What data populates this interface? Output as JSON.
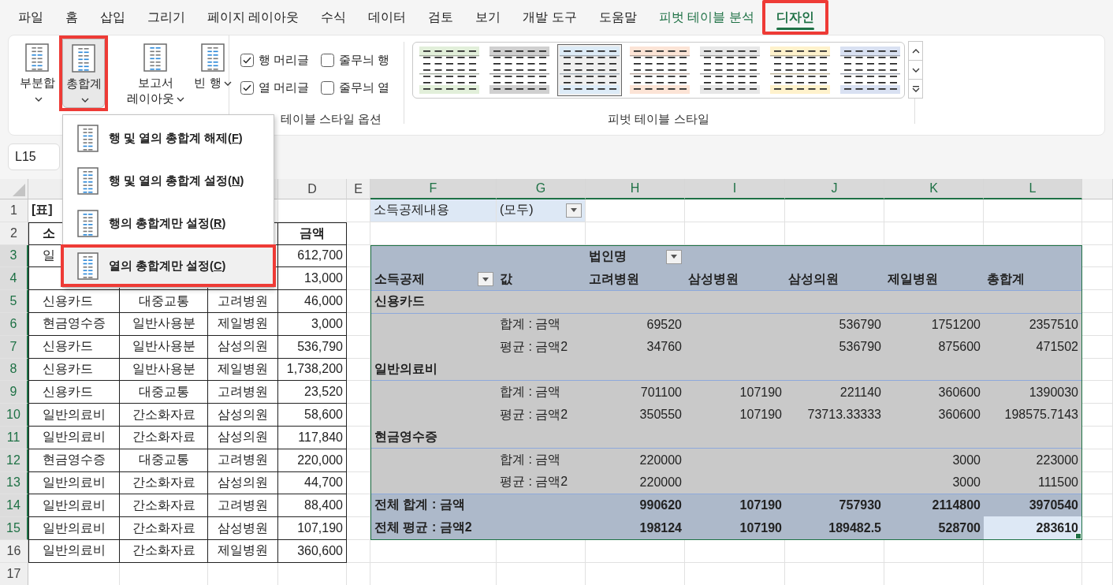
{
  "tabs": [
    {
      "label": "파일",
      "selected": false,
      "contextual": false,
      "highlighted": false
    },
    {
      "label": "홈",
      "selected": false,
      "contextual": false,
      "highlighted": false
    },
    {
      "label": "삽입",
      "selected": false,
      "contextual": false,
      "highlighted": false
    },
    {
      "label": "그리기",
      "selected": false,
      "contextual": false,
      "highlighted": false
    },
    {
      "label": "페이지 레이아웃",
      "selected": false,
      "contextual": false,
      "highlighted": false
    },
    {
      "label": "수식",
      "selected": false,
      "contextual": false,
      "highlighted": false
    },
    {
      "label": "데이터",
      "selected": false,
      "contextual": false,
      "highlighted": false
    },
    {
      "label": "검토",
      "selected": false,
      "contextual": false,
      "highlighted": false
    },
    {
      "label": "보기",
      "selected": false,
      "contextual": false,
      "highlighted": false
    },
    {
      "label": "개발 도구",
      "selected": false,
      "contextual": false,
      "highlighted": false
    },
    {
      "label": "도움말",
      "selected": false,
      "contextual": false,
      "highlighted": false
    },
    {
      "label": "피벗 테이블 분석",
      "selected": false,
      "contextual": true,
      "highlighted": false
    },
    {
      "label": "디자인",
      "selected": true,
      "contextual": true,
      "highlighted": true
    }
  ],
  "ribbon": {
    "layout_buttons": [
      {
        "label": "부분합",
        "pressed": false,
        "highlighted": false
      },
      {
        "label": "총합계",
        "pressed": true,
        "highlighted": true
      },
      {
        "label": "보고서 레이아웃",
        "pressed": false,
        "highlighted": false
      },
      {
        "label": "빈 행",
        "pressed": false,
        "highlighted": false
      }
    ],
    "options": [
      {
        "label": "행 머리글",
        "checked": true
      },
      {
        "label": "줄무늬 행",
        "checked": false
      },
      {
        "label": "열 머리글",
        "checked": true
      },
      {
        "label": "줄무늬 열",
        "checked": false
      }
    ],
    "options_group_label": "테이블 스타일 옵션",
    "styles": [
      {
        "color": "#e2efda",
        "selected": false
      },
      {
        "color": "#d0d0d0",
        "selected": false
      },
      {
        "color": "#ddebf7",
        "selected": true
      },
      {
        "color": "#fce4d6",
        "selected": false
      },
      {
        "color": "#e7e7e7",
        "selected": false
      },
      {
        "color": "#fff2cc",
        "selected": false
      },
      {
        "color": "#d9e1f2",
        "selected": false
      }
    ],
    "styles_group_label": "피벗 테이블 스타일"
  },
  "menu": [
    {
      "label": "행 및 열의 총합계 해제(F)",
      "selected": false,
      "highlighted": false
    },
    {
      "label": "행 및 열의 총합계 설정(N)",
      "selected": false,
      "highlighted": false
    },
    {
      "label": "행의 총합계만 설정(R)",
      "selected": false,
      "highlighted": false
    },
    {
      "label": "열의 총합계만 설정(C)",
      "selected": true,
      "highlighted": true
    }
  ],
  "name_box": "L15",
  "sheet": {
    "col_headers": [
      {
        "label": "D",
        "selected": false
      },
      {
        "label": "E",
        "selected": false
      },
      {
        "label": "F",
        "selected": true
      },
      {
        "label": "G",
        "selected": true
      },
      {
        "label": "H",
        "selected": true
      },
      {
        "label": "I",
        "selected": true
      },
      {
        "label": "J",
        "selected": true
      },
      {
        "label": "K",
        "selected": true
      },
      {
        "label": "L",
        "selected": true
      }
    ],
    "row_headers": [
      {
        "label": "1",
        "selected": false
      },
      {
        "label": "2",
        "selected": false
      },
      {
        "label": "3",
        "selected": true
      },
      {
        "label": "4",
        "selected": true
      },
      {
        "label": "5",
        "selected": true
      },
      {
        "label": "6",
        "selected": true
      },
      {
        "label": "7",
        "selected": true
      },
      {
        "label": "8",
        "selected": true
      },
      {
        "label": "9",
        "selected": true
      },
      {
        "label": "10",
        "selected": true
      },
      {
        "label": "11",
        "selected": true
      },
      {
        "label": "12",
        "selected": true
      },
      {
        "label": "13",
        "selected": true
      },
      {
        "label": "14",
        "selected": true
      },
      {
        "label": "15",
        "selected": true
      },
      {
        "label": "16",
        "selected": false
      },
      {
        "label": "17",
        "selected": false
      }
    ],
    "table": {
      "title": "[표]",
      "header": {
        "column_1": "소",
        "column_4": "금액"
      },
      "rows": [
        {
          "column_1": "일",
          "column_4": "612,700"
        },
        {
          "column_4": "13,000"
        },
        {
          "column_1": "신용카드",
          "column_2": "대중교통",
          "column_3": "고려병원",
          "column_4": "46,000"
        },
        {
          "column_1": "현금영수증",
          "column_2": "일반사용분",
          "column_3": "제일병원",
          "column_4": "3,000"
        },
        {
          "column_1": "신용카드",
          "column_2": "일반사용분",
          "column_3": "삼성의원",
          "column_4": "536,790"
        },
        {
          "column_1": "신용카드",
          "column_2": "일반사용분",
          "column_3": "제일병원",
          "column_4": "1,738,200"
        },
        {
          "column_1": "신용카드",
          "column_2": "대중교통",
          "column_3": "고려병원",
          "column_4": "23,520"
        },
        {
          "column_1": "일반의료비",
          "column_2": "간소화자료",
          "column_3": "삼성의원",
          "column_4": "58,600"
        },
        {
          "column_1": "일반의료비",
          "column_2": "간소화자료",
          "column_3": "삼성의원",
          "column_4": "117,840"
        },
        {
          "column_1": "현금영수증",
          "column_2": "대중교통",
          "column_3": "고려병원",
          "column_4": "220,000"
        },
        {
          "column_1": "일반의료비",
          "column_2": "간소화자료",
          "column_3": "삼성의원",
          "column_4": "44,700"
        },
        {
          "column_1": "일반의료비",
          "column_2": "간소화자료",
          "column_3": "고려병원",
          "column_4": "88,400"
        },
        {
          "column_1": "일반의료비",
          "column_2": "간소화자료",
          "column_3": "삼성병원",
          "column_4": "107,190"
        },
        {
          "column_1": "일반의료비",
          "column_2": "간소화자료",
          "column_3": "제일병원",
          "column_4": "360,600"
        }
      ]
    },
    "pivot": {
      "filter": {
        "label": "소득공제내용",
        "value": "(모두)"
      },
      "column_field": "법인명",
      "row_field": "소득공제",
      "values_label": "값",
      "columns": [
        "고려병원",
        "삼성병원",
        "삼성의원",
        "제일병원",
        "총합계"
      ],
      "groups": [
        {
          "name": "신용카드",
          "rows": [
            {
              "label": "합계 : 금액",
              "values": {
                "column_1": "69520",
                "column_3": "536790",
                "column_4": "1751200",
                "column_5": "2357510"
              }
            },
            {
              "label": "평균 : 금액2",
              "values": {
                "column_1": "34760",
                "column_3": "536790",
                "column_4": "875600",
                "column_5": "471502"
              }
            }
          ]
        },
        {
          "name": "일반의료비",
          "rows": [
            {
              "label": "합계 : 금액",
              "values": {
                "column_1": "701100",
                "column_2": "107190",
                "column_3": "221140",
                "column_4": "360600",
                "column_5": "1390030"
              }
            },
            {
              "label": "평균 : 금액2",
              "values": {
                "column_1": "350550",
                "column_2": "107190",
                "column_3": "73713.33333",
                "column_4": "360600",
                "column_5": "198575.7143"
              }
            }
          ]
        },
        {
          "name": "현금영수증",
          "rows": [
            {
              "label": "합계 : 금액",
              "values": {
                "column_1": "220000",
                "column_4": "3000",
                "column_5": "223000"
              }
            },
            {
              "label": "평균 : 금액2",
              "values": {
                "column_1": "220000",
                "column_4": "3000",
                "column_5": "111500"
              }
            }
          ]
        }
      ],
      "totals": [
        {
          "label": "전체 합계 : 금액",
          "values": [
            {
              "text": "990620",
              "selected": false
            },
            {
              "text": "107190",
              "selected": false
            },
            {
              "text": "757930",
              "selected": false
            },
            {
              "text": "2114800",
              "selected": false
            },
            {
              "text": "3970540",
              "selected": false
            }
          ]
        },
        {
          "label": "전체 평균 : 금액2",
          "values": [
            {
              "text": "198124",
              "selected": false
            },
            {
              "text": "107190",
              "selected": false
            },
            {
              "text": "189482.5",
              "selected": false
            },
            {
              "text": "528700",
              "selected": false
            },
            {
              "text": "283610",
              "selected": true
            }
          ]
        }
      ]
    }
  }
}
